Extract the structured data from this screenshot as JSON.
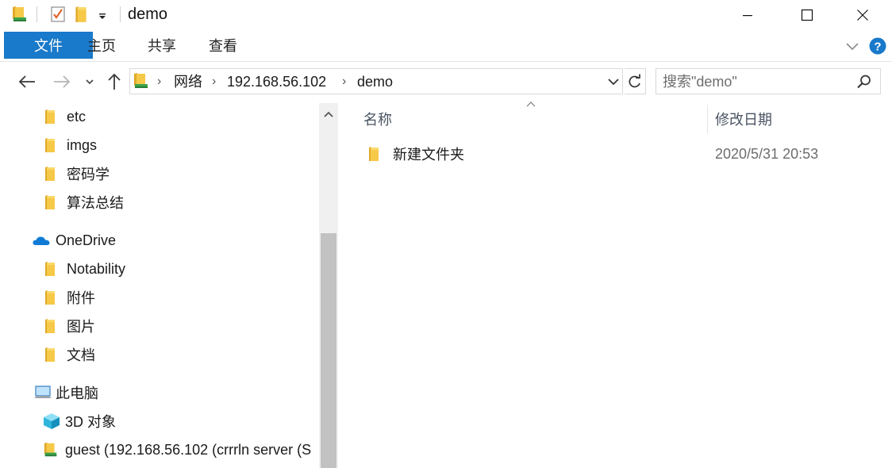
{
  "window": {
    "title": "demo",
    "icons": {
      "app": "drive-folder-icon",
      "properties": "properties-check-icon",
      "new_folder": "folder-icon",
      "customize": "dropdown-arrow-icon"
    },
    "controls": {
      "minimize": "minimize-icon",
      "maximize": "maximize-icon",
      "close": "close-icon"
    }
  },
  "ribbon": {
    "tabs": [
      "文件",
      "主页",
      "共享",
      "查看"
    ],
    "expand_icon": "chevron-down-icon",
    "help_icon": "help-icon",
    "colors": {
      "file_tab": "#1979ca",
      "help": "#1979ca"
    }
  },
  "address": {
    "crumbs": [
      "网络",
      "192.168.56.102",
      "demo"
    ],
    "back_icon": "back-arrow-icon",
    "forward_icon": "forward-arrow-icon",
    "recent_icon": "chevron-down-icon",
    "up_icon": "up-arrow-icon",
    "dropdown_icon": "chevron-down-icon",
    "refresh_icon": "refresh-icon"
  },
  "search": {
    "placeholder": "搜索\"demo\"",
    "icon": "search-icon"
  },
  "navpane": {
    "folders": [
      "etc",
      "imgs",
      "密码学",
      "算法总结"
    ],
    "onedrive": {
      "label": "OneDrive",
      "icon": "onedrive-cloud-icon"
    },
    "onedrive_folders": [
      "Notability",
      "附件",
      "图片",
      "文档"
    ],
    "this_pc": {
      "label": "此电脑",
      "icon": "computer-icon"
    },
    "pc_items": [
      {
        "label": "3D 对象",
        "icon": "cube-3d-icon"
      },
      {
        "label": "guest (192.168.56.102 (crrrln server (S",
        "icon": "network-drive-icon"
      }
    ]
  },
  "content": {
    "columns": {
      "name": "名称",
      "date": "修改日期"
    },
    "sort_icon": "sort-up-icon",
    "rows": [
      {
        "name": "新建文件夹",
        "date": "2020/5/31 20:53",
        "icon": "folder-icon"
      }
    ]
  },
  "colors": {
    "folder": "#f4c542",
    "folder_dark": "#e0a92a",
    "onedrive": "#0f7bd6"
  }
}
